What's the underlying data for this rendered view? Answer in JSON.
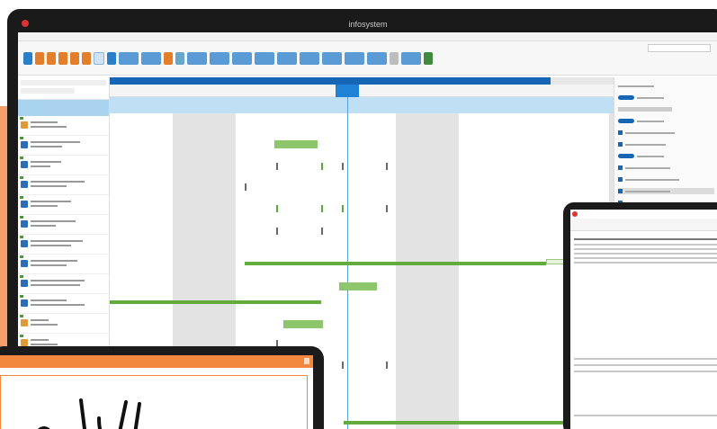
{
  "brand": {
    "name": "infosystem"
  },
  "colors": {
    "accent": "#1765b5",
    "bar_green": "#63ab3d",
    "orange": "#f2873e",
    "weekend_gray": "#e3e3e3"
  },
  "icons": [
    "app-logo-icon",
    "close-icon",
    "signature-mark"
  ]
}
